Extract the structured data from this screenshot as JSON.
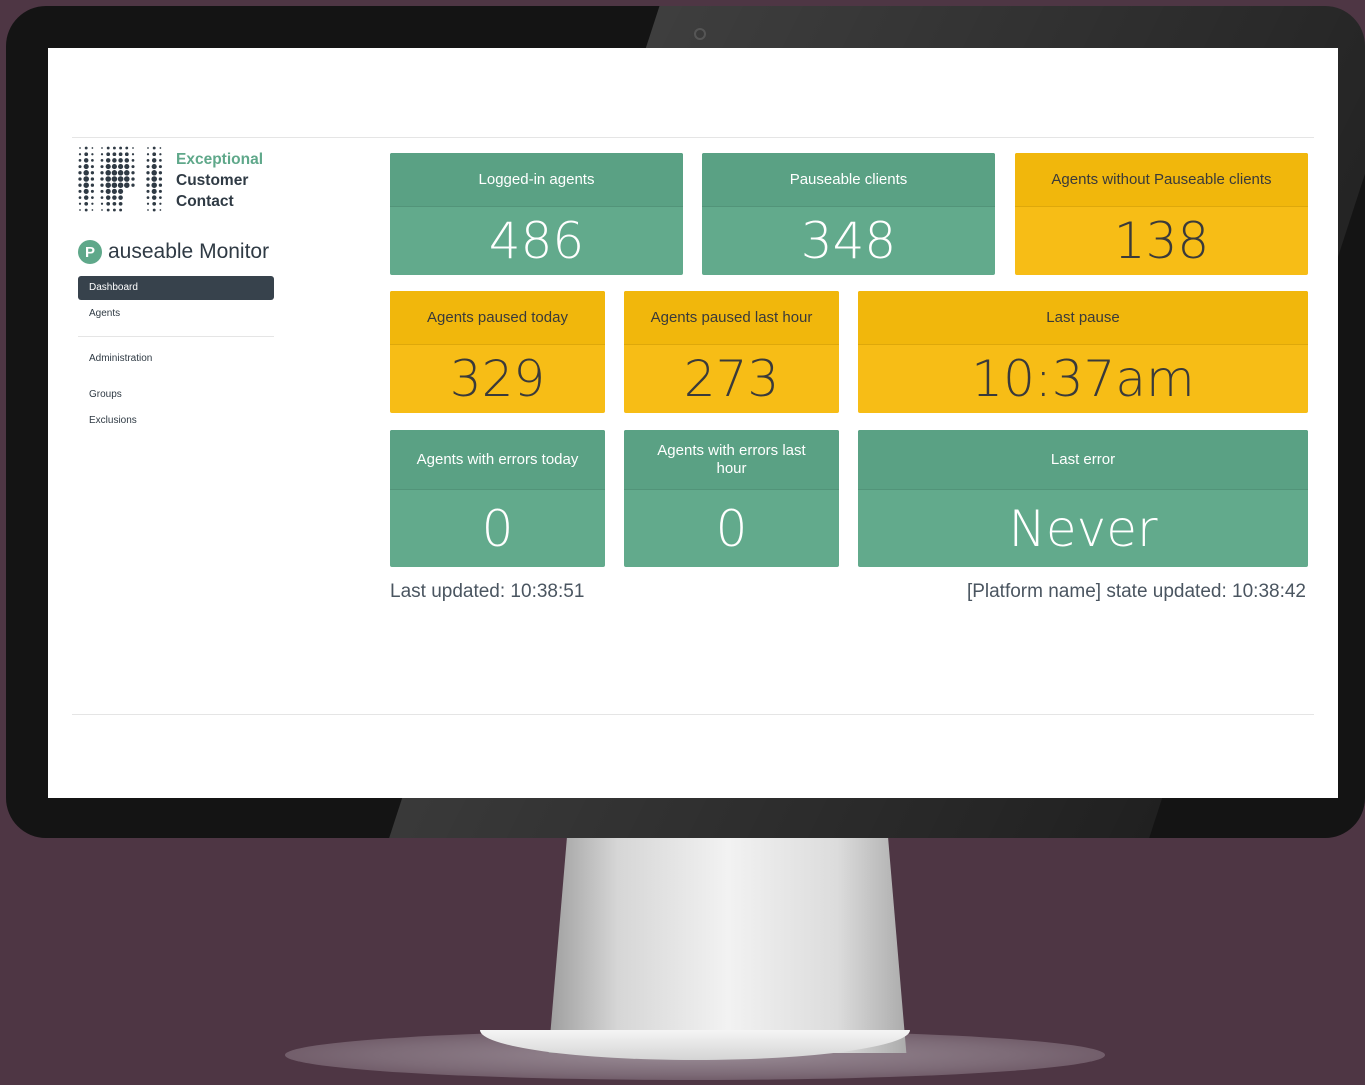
{
  "brand": {
    "line1": "Exceptional",
    "line2": "Customer",
    "line3": "Contact"
  },
  "app": {
    "logo_letter": "P",
    "title": "auseable Monitor"
  },
  "nav": {
    "dashboard": "Dashboard",
    "agents": "Agents",
    "administration": "Administration",
    "groups": "Groups",
    "exclusions": "Exclusions"
  },
  "tiles": {
    "logged_in": {
      "label": "Logged-in agents",
      "value": "486"
    },
    "pauseable_clients": {
      "label": "Pauseable clients",
      "value": "348"
    },
    "without_clients": {
      "label": "Agents without Pauseable clients",
      "value": "138"
    },
    "paused_today": {
      "label": "Agents paused today",
      "value": "329"
    },
    "paused_last_hour": {
      "label": "Agents paused last hour",
      "value": "273"
    },
    "last_pause": {
      "label": "Last pause",
      "value": "10:37am"
    },
    "errors_today": {
      "label": "Agents with errors today",
      "value": "0"
    },
    "errors_last_hour": {
      "label": "Agents with errors last hour",
      "value": "0"
    },
    "last_error": {
      "label": "Last error",
      "value": "Never"
    }
  },
  "status": {
    "last_updated": "Last updated: 10:38:51",
    "platform_updated": "[Platform name] state updated: 10:38:42"
  },
  "colors": {
    "green": "#62aa8c",
    "yellow": "#f7bd16",
    "nav_active": "#37424c",
    "background": "#4e3644"
  }
}
